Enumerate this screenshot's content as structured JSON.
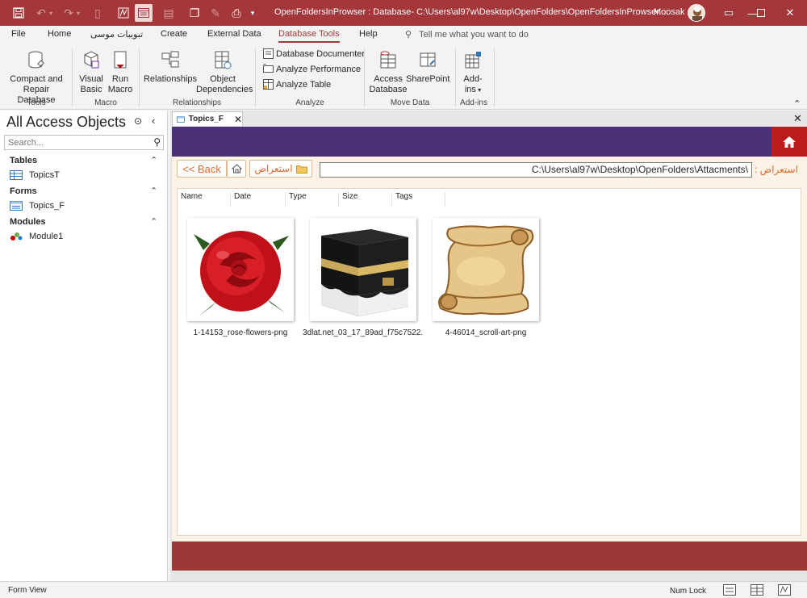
{
  "window": {
    "title": "OpenFoldersInProwser : Database- C:\\Users\\al97w\\Desktop\\OpenFolders\\OpenFoldersInProwser....",
    "user": "Moosak",
    "accent": "#a4373a"
  },
  "menu": {
    "tabs": [
      "File",
      "Home",
      "تبويبات موسى",
      "Create",
      "External Data",
      "Database Tools",
      "Help"
    ],
    "selected": "Database Tools",
    "tell_me": "Tell me what you want to do"
  },
  "ribbon": {
    "tools": {
      "compact_l1": "Compact and",
      "compact_l2": "Repair Database",
      "group": "Tools"
    },
    "macro": {
      "vb_l1": "Visual",
      "vb_l2": "Basic",
      "run_l1": "Run",
      "run_l2": "Macro",
      "group": "Macro"
    },
    "relationships": {
      "rel": "Relationships",
      "dep_l1": "Object",
      "dep_l2": "Dependencies",
      "group": "Relationships"
    },
    "analyze": {
      "documenter": "Database Documenter",
      "performance": "Analyze Performance",
      "table": "Analyze Table",
      "group": "Analyze"
    },
    "move": {
      "access_l1": "Access",
      "access_l2": "Database",
      "sharepoint": "SharePoint",
      "group": "Move Data"
    },
    "addins": {
      "l1": "Add-",
      "l2": "ins",
      "group": "Add-ins"
    }
  },
  "nav": {
    "title": "All Access Objects",
    "search_placeholder": "Search...",
    "groups": [
      {
        "label": "Tables",
        "items": [
          "TopicsT"
        ]
      },
      {
        "label": "Forms",
        "items": [
          "Topics_F"
        ]
      },
      {
        "label": "Modules",
        "items": [
          "Module1"
        ]
      }
    ]
  },
  "document": {
    "tab": "Topics_F",
    "back_label": "<< Back",
    "browse_label": "استعراض",
    "path": "C:\\Users\\al97w\\Desktop\\OpenFolders\\Attacments\\",
    "path_label": "استعراض :",
    "columns": [
      "Name",
      "Date",
      "Type",
      "Size",
      "Tags"
    ],
    "files": [
      {
        "name": "1-14153_rose-flowers-png",
        "icon": "rose-image"
      },
      {
        "name": "3dlat.net_03_17_89ad_f75c7522...",
        "icon": "kaaba-image"
      },
      {
        "name": "4-46014_scroll-art-png",
        "icon": "scroll-image"
      }
    ],
    "colors": {
      "header": "#4c3178",
      "home": "#bd1b1b",
      "footer": "#9b3838",
      "body": "#fdf3e7"
    }
  },
  "status": {
    "left": "Form View",
    "numlock": "Num Lock"
  }
}
